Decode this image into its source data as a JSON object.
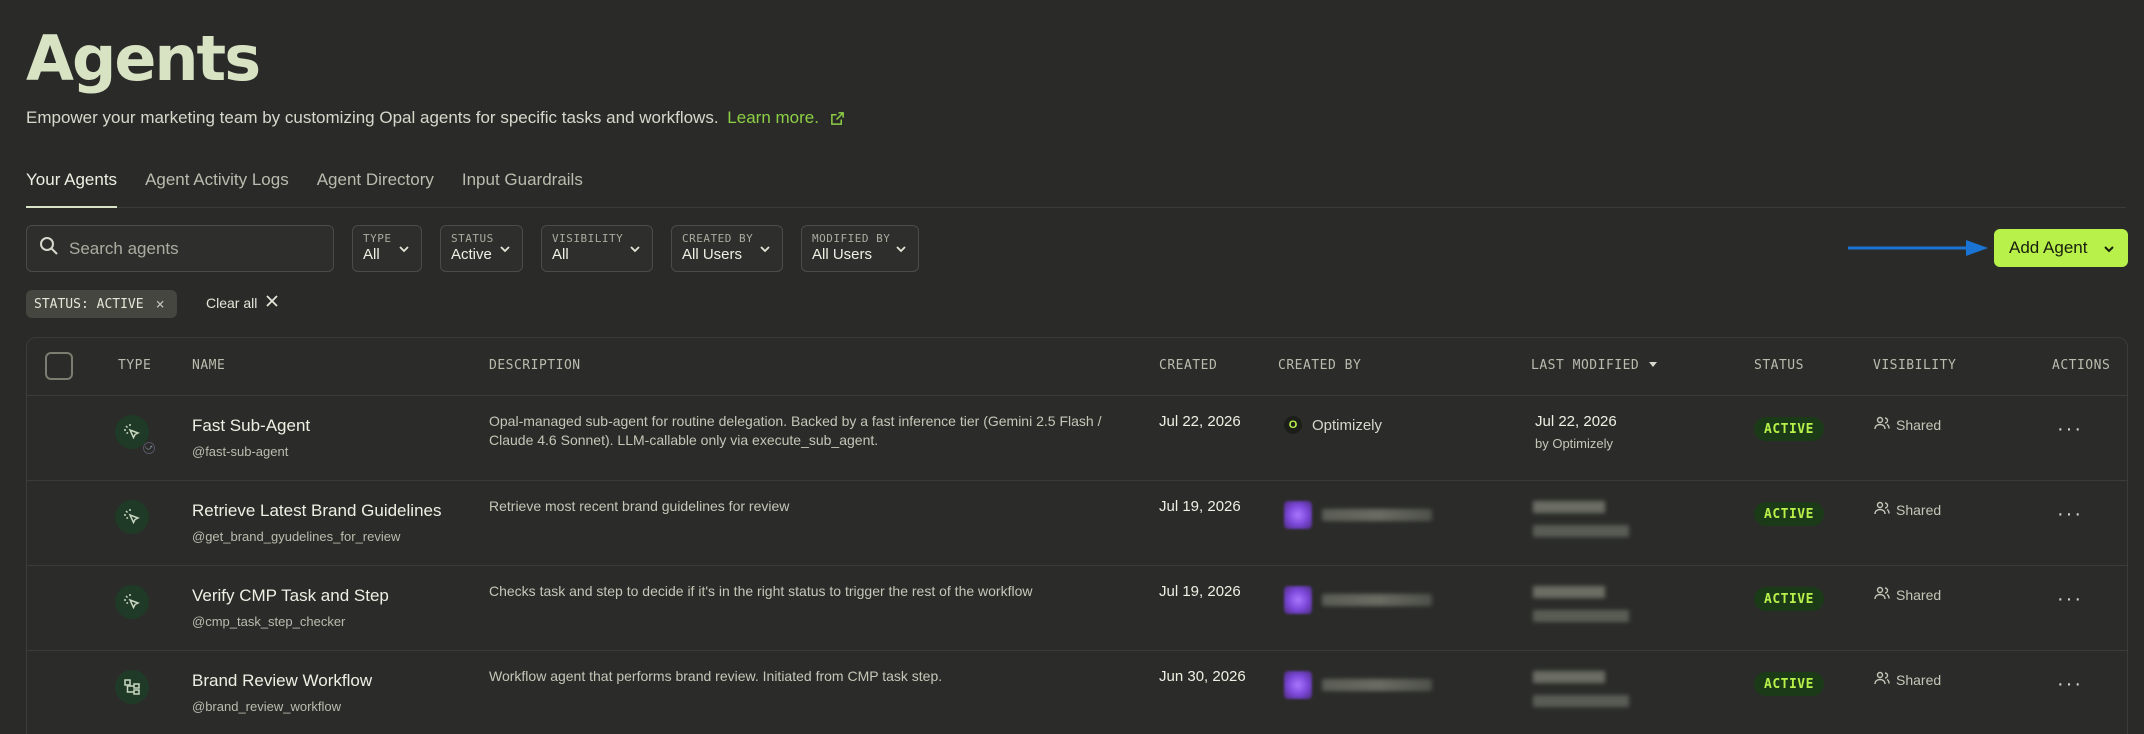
{
  "header": {
    "title": "Agents",
    "subtitle": "Empower your marketing team by customizing Opal agents for specific tasks and workflows.",
    "learn_more": "Learn more."
  },
  "tabs": [
    {
      "label": "Your Agents",
      "active": true
    },
    {
      "label": "Agent Activity Logs"
    },
    {
      "label": "Agent Directory"
    },
    {
      "label": "Input Guardrails"
    }
  ],
  "search": {
    "placeholder": "Search agents"
  },
  "filters": [
    {
      "label": "TYPE",
      "value": "All"
    },
    {
      "label": "STATUS",
      "value": "Active"
    },
    {
      "label": "VISIBILITY",
      "value": "All"
    },
    {
      "label": "CREATED BY",
      "value": "All Users"
    },
    {
      "label": "MODIFIED BY",
      "value": "All Users"
    }
  ],
  "add_agent": {
    "label": "Add Agent",
    "color": "#b7f14a"
  },
  "active_filter_chip": {
    "label": "STATUS: ACTIVE"
  },
  "clear_all": "Clear all",
  "table": {
    "columns": [
      "TYPE",
      "NAME",
      "DESCRIPTION",
      "CREATED",
      "CREATED BY",
      "LAST MODIFIED",
      "STATUS",
      "VISIBILITY",
      "ACTIONS"
    ],
    "rows": [
      {
        "icon": "sub-agent-icon",
        "name": "Fast Sub-Agent",
        "handle": "@fast-sub-agent",
        "description": "Opal-managed sub-agent for routine delegation. Backed by a fast inference tier (Gemini 2.5 Flash / Claude 4.6 Sonnet). LLM-callable only via execute_sub_agent.",
        "created": "Jul 22, 2026",
        "created_by": "Optimizely",
        "last_modified": "Jul 22, 2026",
        "modified_by": "by Optimizely",
        "status": "ACTIVE",
        "visibility": "Shared"
      },
      {
        "icon": "sub-agent-icon",
        "name": "Retrieve Latest Brand Guidelines",
        "handle": "@get_brand_gyudelines_for_review",
        "description": "Retrieve most recent brand guidelines for review",
        "created": "Jul 19, 2026",
        "status": "ACTIVE",
        "visibility": "Shared"
      },
      {
        "icon": "sub-agent-icon",
        "name": "Verify CMP Task and Step",
        "handle": "@cmp_task_step_checker",
        "description": "Checks task and step to decide if it's in the right status to trigger the rest of the workflow",
        "created": "Jul 19, 2026",
        "status": "ACTIVE",
        "visibility": "Shared"
      },
      {
        "icon": "workflow-icon",
        "name": "Brand Review Workflow",
        "handle": "@brand_review_workflow",
        "description": "Workflow agent that performs brand review. Initiated from CMP task step.",
        "created": "Jun 30, 2026",
        "status": "ACTIVE",
        "visibility": "Shared"
      }
    ]
  }
}
